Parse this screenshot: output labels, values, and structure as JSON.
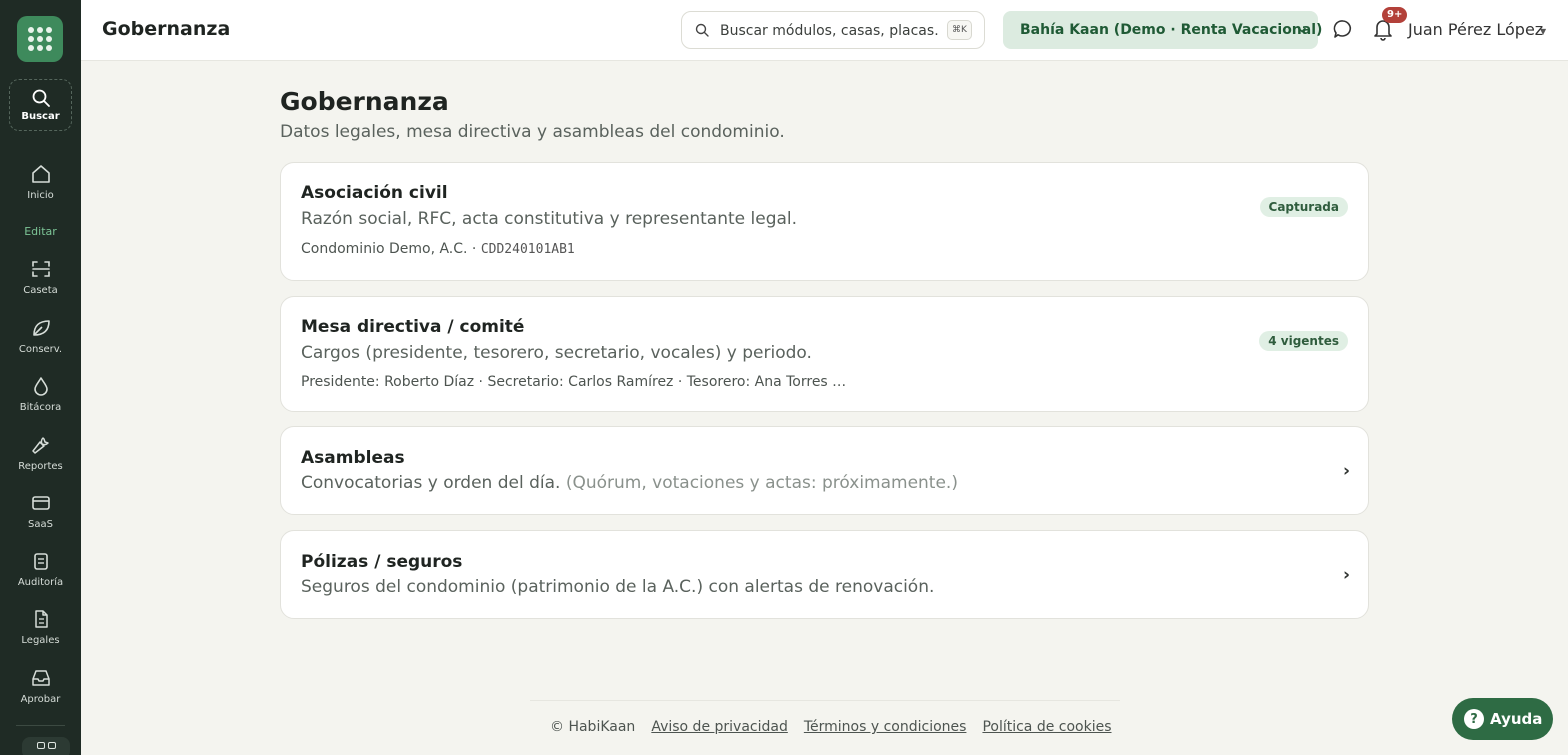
{
  "sidebar": {
    "search_label": "Buscar",
    "section_label": "Editar",
    "items": [
      {
        "label": "Inicio",
        "icon": "home-icon"
      },
      {
        "label": "Caseta",
        "icon": "scan-icon"
      },
      {
        "label": "Conserv.",
        "icon": "leaf-icon"
      },
      {
        "label": "Bitácora",
        "icon": "drop-icon"
      },
      {
        "label": "Reportes",
        "icon": "wrench-icon"
      },
      {
        "label": "SaaS",
        "icon": "card-icon"
      },
      {
        "label": "Auditoría",
        "icon": "clipboard-icon"
      },
      {
        "label": "Legales",
        "icon": "document-icon"
      },
      {
        "label": "Aprobar",
        "icon": "inbox-icon"
      }
    ]
  },
  "header": {
    "title": "Gobernanza",
    "search_placeholder": "Buscar módulos, casas, placas…",
    "search_shortcut": "⌘K",
    "org_selector": "Bahía Kaan (Demo · Renta Vacacional)",
    "notifications_badge": "9+",
    "user_name": "Juan Pérez López"
  },
  "main": {
    "title": "Gobernanza",
    "subtitle": "Datos legales, mesa directiva y asambleas del condominio.",
    "cards": [
      {
        "title": "Asociación civil",
        "description": "Razón social, RFC, acta constitutiva y representante legal.",
        "meta_name": "Condominio Demo, A.C. · ",
        "meta_rfc": "CDD240101AB1",
        "status": "Capturada"
      },
      {
        "title": "Mesa directiva / comité",
        "description": "Cargos (presidente, tesorero, secretario, vocales) y periodo.",
        "meta": "Presidente: Roberto Díaz · Secretario: Carlos Ramírez · Tesorero: Ana Torres …",
        "status": "4 vigentes"
      },
      {
        "title": "Asambleas",
        "description": "Convocatorias y orden del día.",
        "description_note": "(Quórum, votaciones y actas: próximamente.)"
      },
      {
        "title": "Pólizas / seguros",
        "description": "Seguros del condominio (patrimonio de la A.C.) con alertas de renovación."
      }
    ]
  },
  "footer": {
    "copyright": "© HabiKaan",
    "links": [
      "Aviso de privacidad",
      "Términos y condiciones",
      "Política de cookies"
    ]
  },
  "help_button": "Ayuda",
  "colors": {
    "sidebar_bg": "#1f2b25",
    "accent": "#3e8a5c",
    "background": "#f4f4ef"
  }
}
